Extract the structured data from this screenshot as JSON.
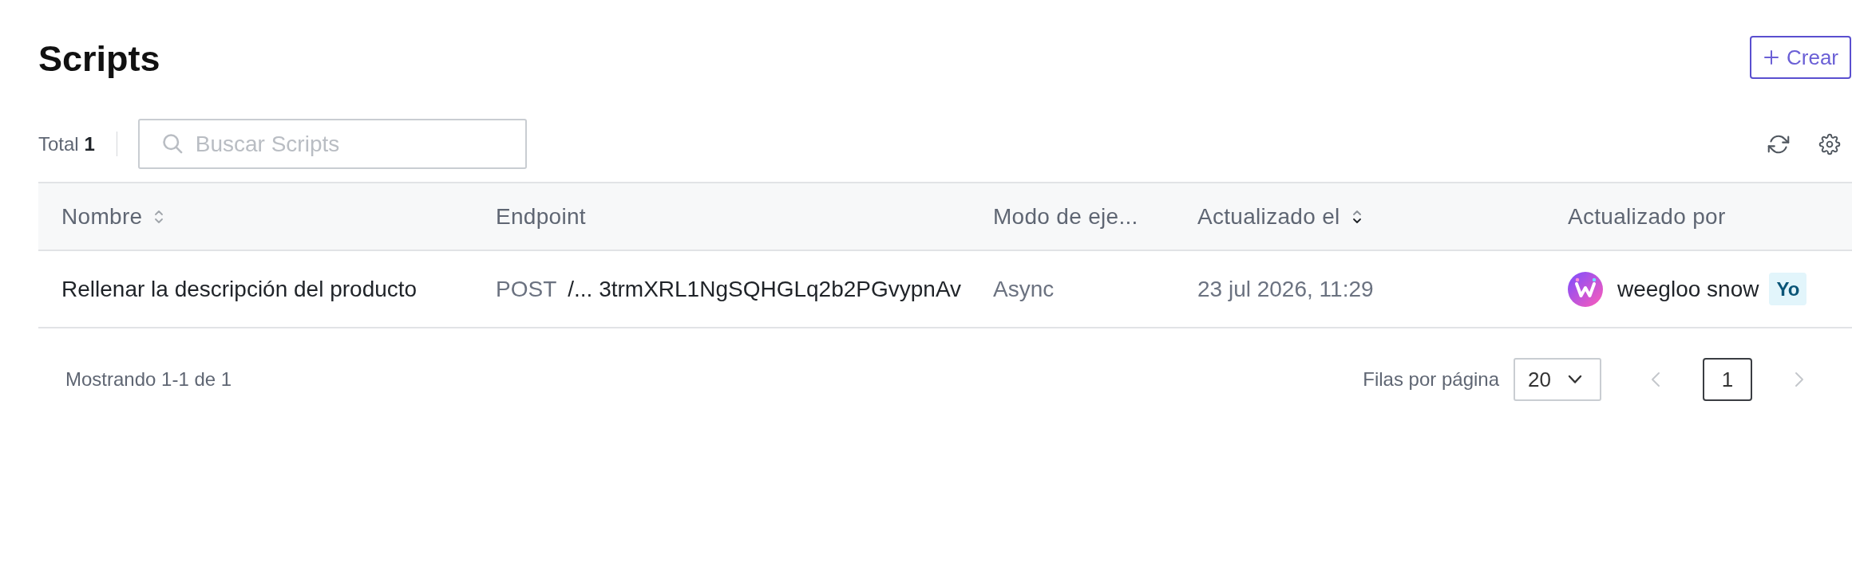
{
  "header": {
    "title": "Scripts",
    "create_button": {
      "label": "Crear"
    }
  },
  "toolbar": {
    "total": "Total **1**",
    "search": {
      "placeholder": "Buscar Scripts"
    }
  },
  "table": {
    "columns": [
      {
        "label": "Nombre",
        "sortable": true,
        "sorted": false
      },
      {
        "label": "Endpoint"
      },
      {
        "label": "Modo de eje..."
      },
      {
        "label": "Actualizado el",
        "sortable": true,
        "sorted": true
      },
      {
        "label": "Actualizado por"
      }
    ],
    "rows": [
      {
        "name": "Rellenar la descripción del producto",
        "method": "POST",
        "endpoint": "/... 3trmXRL1NgSQHGLq2b2PGvypnAv",
        "mode": "Async",
        "updated_at": "23 jul 2026, 11:29",
        "updated_by": {
          "name": "weegloo snow",
          "badge": "Yo"
        }
      }
    ]
  },
  "pagination": {
    "summary": "Mostrando 1-1 de 1",
    "rows_per_page_label": "Filas por página",
    "rows_per_page": "20",
    "prev": {
      "disabled": true
    },
    "pages": [
      {
        "label": "1",
        "selected": true
      }
    ],
    "next": {
      "disabled": true
    }
  }
}
